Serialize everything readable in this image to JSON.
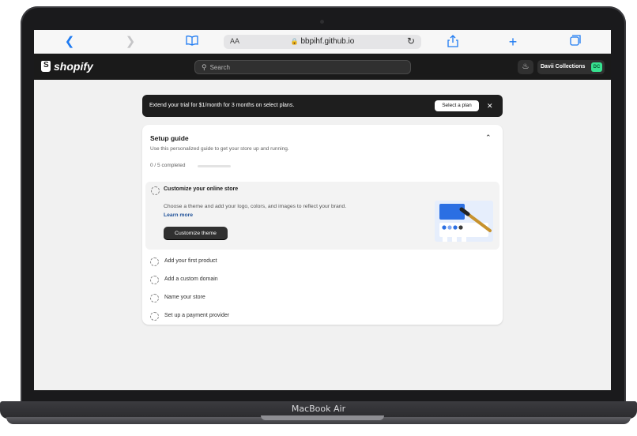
{
  "device": {
    "model_label": "MacBook Air"
  },
  "browser": {
    "back_icon": "‹",
    "forward_icon": "›",
    "aa_label": "AA",
    "url": "bbpihf.github.io"
  },
  "topbar": {
    "brand": "shopify",
    "search_placeholder": "Search",
    "store_name": "Davii Collections",
    "store_initials": "DC",
    "accent": "#37e290"
  },
  "banner": {
    "text": "Extend your trial for $1/month for 3 months on select plans.",
    "button_label": "Select a plan"
  },
  "setup_guide": {
    "title": "Setup guide",
    "subtitle": "Use this personalized guide to get your store up and running.",
    "progress_text": "0 / 5 completed",
    "progress_fraction": 0,
    "active_task": {
      "title": "Customize your online store",
      "description": "Choose a theme and add your logo, colors, and images to reflect your brand.",
      "link_label": "Learn more",
      "button_label": "Customize theme"
    },
    "tasks": [
      {
        "title": "Add your first product"
      },
      {
        "title": "Add a custom domain"
      },
      {
        "title": "Name your store"
      },
      {
        "title": "Set up a payment provider"
      }
    ]
  }
}
